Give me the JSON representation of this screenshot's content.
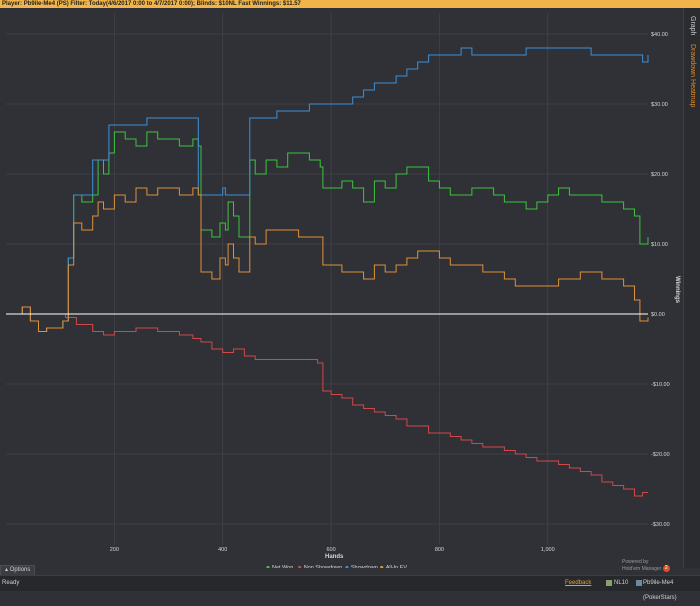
{
  "header": {
    "player_label": "Player:",
    "player_value": "Pb9ile-Me4 (PS)",
    "filter_label": "Filter:",
    "filter_value": "Today(4/6/2017 0:00 to 4/7/2017 0:00); Blinds: $10NL Fast",
    "winnings_label": "Winnings:",
    "winnings_value": "$11.57"
  },
  "side_tabs": {
    "graph": "Graph",
    "drawer": "Drawdown Heatmap"
  },
  "options_label": "Options",
  "status": {
    "ready": "Ready",
    "feedback": "Feedback",
    "limit": "NL10",
    "player": "Pb9ile-Me4 (PokerStars)"
  },
  "powered_by": {
    "line1": "Powered by",
    "line2": "Hold'em Manager",
    "logo_text": "2"
  },
  "colors": {
    "net_won": "#3ec43e",
    "non_showdown": "#d24848",
    "showdown": "#3d8fd6",
    "all_in_ev": "#e0903a",
    "zero_line": "#ffffff",
    "grid": "#43464c",
    "background": "#2f3136"
  },
  "chart_data": {
    "type": "line",
    "xlabel": "Hands",
    "ylabel": "Winnings",
    "xlim": [
      0,
      1185
    ],
    "ylim": [
      -33,
      43
    ],
    "x_ticks": [
      200,
      400,
      600,
      800,
      1000
    ],
    "x_tick_labels": [
      "200",
      "400",
      "600",
      "800",
      "1,000"
    ],
    "y_ticks": [
      40,
      30,
      20,
      10,
      0,
      -10,
      -20,
      -30
    ],
    "y_tick_labels": [
      "$40.00",
      "$30.00",
      "$20.00",
      "$10.00",
      "$0.00",
      "-$10.00",
      "-$20.00",
      "-$30.00"
    ],
    "grid": true,
    "legend_position": "bottom",
    "series": [
      {
        "name": "Net Won",
        "color": "#3ec43e",
        "points": [
          [
            0,
            0
          ],
          [
            30,
            1
          ],
          [
            45,
            -1
          ],
          [
            60,
            -2.5
          ],
          [
            75,
            -2
          ],
          [
            105,
            -1
          ],
          [
            115,
            8
          ],
          [
            125,
            17
          ],
          [
            140,
            16
          ],
          [
            160,
            17
          ],
          [
            170,
            22
          ],
          [
            180,
            20
          ],
          [
            190,
            23
          ],
          [
            200,
            26
          ],
          [
            220,
            25
          ],
          [
            240,
            24
          ],
          [
            260,
            26
          ],
          [
            280,
            25
          ],
          [
            320,
            24
          ],
          [
            345,
            25
          ],
          [
            355,
            24
          ],
          [
            360,
            12
          ],
          [
            380,
            11
          ],
          [
            395,
            13
          ],
          [
            405,
            12
          ],
          [
            410,
            16
          ],
          [
            420,
            14
          ],
          [
            430,
            11
          ],
          [
            445,
            11
          ],
          [
            450,
            22
          ],
          [
            460,
            20
          ],
          [
            480,
            22
          ],
          [
            500,
            21
          ],
          [
            520,
            23
          ],
          [
            540,
            23
          ],
          [
            560,
            22
          ],
          [
            580,
            21
          ],
          [
            585,
            18
          ],
          [
            595,
            18
          ],
          [
            620,
            19
          ],
          [
            640,
            18
          ],
          [
            660,
            16
          ],
          [
            680,
            19
          ],
          [
            700,
            18
          ],
          [
            720,
            20
          ],
          [
            740,
            21
          ],
          [
            760,
            21
          ],
          [
            780,
            19
          ],
          [
            800,
            18
          ],
          [
            820,
            17
          ],
          [
            840,
            17
          ],
          [
            860,
            18
          ],
          [
            880,
            18
          ],
          [
            900,
            17
          ],
          [
            920,
            16
          ],
          [
            940,
            16
          ],
          [
            960,
            15
          ],
          [
            980,
            16
          ],
          [
            1000,
            17
          ],
          [
            1020,
            18
          ],
          [
            1040,
            17
          ],
          [
            1060,
            17
          ],
          [
            1080,
            17
          ],
          [
            1100,
            16
          ],
          [
            1120,
            16
          ],
          [
            1140,
            15
          ],
          [
            1160,
            14
          ],
          [
            1170,
            10
          ],
          [
            1185,
            11
          ]
        ]
      },
      {
        "name": "Non Showdown",
        "color": "#d24848",
        "points": [
          [
            0,
            0
          ],
          [
            30,
            0
          ],
          [
            60,
            0
          ],
          [
            90,
            0
          ],
          [
            110,
            -0.5
          ],
          [
            130,
            -1.5
          ],
          [
            160,
            -2.5
          ],
          [
            180,
            -3
          ],
          [
            200,
            -2.5
          ],
          [
            240,
            -2
          ],
          [
            280,
            -2.5
          ],
          [
            320,
            -3
          ],
          [
            345,
            -3.5
          ],
          [
            360,
            -4
          ],
          [
            380,
            -5
          ],
          [
            400,
            -5.5
          ],
          [
            420,
            -5
          ],
          [
            440,
            -6
          ],
          [
            460,
            -6.5
          ],
          [
            480,
            -6.5
          ],
          [
            500,
            -6.5
          ],
          [
            520,
            -6.5
          ],
          [
            540,
            -6.5
          ],
          [
            560,
            -6.5
          ],
          [
            575,
            -7
          ],
          [
            585,
            -11
          ],
          [
            600,
            -11.5
          ],
          [
            620,
            -12
          ],
          [
            640,
            -13
          ],
          [
            660,
            -13.5
          ],
          [
            680,
            -14
          ],
          [
            700,
            -14.5
          ],
          [
            720,
            -15
          ],
          [
            740,
            -16
          ],
          [
            760,
            -16
          ],
          [
            780,
            -17
          ],
          [
            800,
            -17
          ],
          [
            820,
            -17.5
          ],
          [
            840,
            -18
          ],
          [
            860,
            -18.5
          ],
          [
            880,
            -19
          ],
          [
            900,
            -19
          ],
          [
            920,
            -19.5
          ],
          [
            940,
            -20
          ],
          [
            960,
            -20.5
          ],
          [
            980,
            -21
          ],
          [
            1000,
            -21
          ],
          [
            1020,
            -21.5
          ],
          [
            1040,
            -22
          ],
          [
            1060,
            -22.5
          ],
          [
            1080,
            -23
          ],
          [
            1100,
            -24
          ],
          [
            1120,
            -24.5
          ],
          [
            1140,
            -25
          ],
          [
            1160,
            -26
          ],
          [
            1175,
            -25.5
          ],
          [
            1185,
            -25.5
          ]
        ]
      },
      {
        "name": "Showdown",
        "color": "#3d8fd6",
        "points": [
          [
            0,
            0
          ],
          [
            30,
            1
          ],
          [
            45,
            -1
          ],
          [
            60,
            -2.5
          ],
          [
            75,
            -2
          ],
          [
            105,
            -1
          ],
          [
            115,
            8
          ],
          [
            125,
            17
          ],
          [
            140,
            17
          ],
          [
            160,
            22
          ],
          [
            175,
            22
          ],
          [
            190,
            27
          ],
          [
            230,
            27
          ],
          [
            260,
            28
          ],
          [
            300,
            28
          ],
          [
            345,
            28
          ],
          [
            355,
            17
          ],
          [
            380,
            17
          ],
          [
            400,
            18
          ],
          [
            405,
            17
          ],
          [
            430,
            17
          ],
          [
            440,
            17
          ],
          [
            450,
            28
          ],
          [
            480,
            28
          ],
          [
            500,
            29
          ],
          [
            540,
            29
          ],
          [
            560,
            30
          ],
          [
            580,
            30
          ],
          [
            600,
            30
          ],
          [
            640,
            31
          ],
          [
            660,
            32
          ],
          [
            680,
            33
          ],
          [
            700,
            33
          ],
          [
            720,
            34
          ],
          [
            740,
            35
          ],
          [
            760,
            36
          ],
          [
            780,
            37
          ],
          [
            800,
            37
          ],
          [
            820,
            37
          ],
          [
            840,
            38
          ],
          [
            860,
            37
          ],
          [
            880,
            37
          ],
          [
            900,
            37
          ],
          [
            920,
            37
          ],
          [
            940,
            37
          ],
          [
            960,
            38
          ],
          [
            980,
            38
          ],
          [
            1000,
            38
          ],
          [
            1020,
            38
          ],
          [
            1040,
            38
          ],
          [
            1060,
            38
          ],
          [
            1080,
            37
          ],
          [
            1100,
            37
          ],
          [
            1120,
            37
          ],
          [
            1140,
            37
          ],
          [
            1160,
            37
          ],
          [
            1175,
            36
          ],
          [
            1185,
            37
          ]
        ]
      },
      {
        "name": "All-In EV",
        "color": "#e0903a",
        "points": [
          [
            0,
            0
          ],
          [
            30,
            1
          ],
          [
            45,
            -1
          ],
          [
            60,
            -2.5
          ],
          [
            75,
            -2
          ],
          [
            105,
            -1
          ],
          [
            115,
            7
          ],
          [
            125,
            13
          ],
          [
            140,
            12
          ],
          [
            160,
            14
          ],
          [
            170,
            16
          ],
          [
            180,
            15
          ],
          [
            200,
            17
          ],
          [
            220,
            16
          ],
          [
            240,
            18
          ],
          [
            260,
            17
          ],
          [
            280,
            18
          ],
          [
            320,
            17
          ],
          [
            345,
            18
          ],
          [
            355,
            17
          ],
          [
            360,
            6
          ],
          [
            380,
            5
          ],
          [
            395,
            8
          ],
          [
            405,
            7
          ],
          [
            410,
            10
          ],
          [
            420,
            8
          ],
          [
            430,
            6
          ],
          [
            445,
            6
          ],
          [
            450,
            11
          ],
          [
            460,
            10
          ],
          [
            480,
            12
          ],
          [
            500,
            12
          ],
          [
            520,
            12
          ],
          [
            540,
            11
          ],
          [
            560,
            11
          ],
          [
            575,
            11
          ],
          [
            585,
            7
          ],
          [
            600,
            7
          ],
          [
            620,
            6
          ],
          [
            640,
            6
          ],
          [
            660,
            5
          ],
          [
            680,
            7
          ],
          [
            700,
            6
          ],
          [
            720,
            7
          ],
          [
            740,
            8
          ],
          [
            760,
            9
          ],
          [
            780,
            9
          ],
          [
            800,
            8
          ],
          [
            820,
            7
          ],
          [
            840,
            7
          ],
          [
            860,
            7
          ],
          [
            880,
            6
          ],
          [
            900,
            6
          ],
          [
            920,
            5
          ],
          [
            940,
            4
          ],
          [
            960,
            4
          ],
          [
            980,
            4
          ],
          [
            1000,
            4
          ],
          [
            1020,
            5
          ],
          [
            1040,
            5
          ],
          [
            1060,
            6
          ],
          [
            1080,
            6
          ],
          [
            1100,
            5
          ],
          [
            1120,
            5
          ],
          [
            1140,
            4
          ],
          [
            1160,
            2
          ],
          [
            1170,
            -1
          ],
          [
            1185,
            -0.5
          ]
        ]
      }
    ]
  }
}
